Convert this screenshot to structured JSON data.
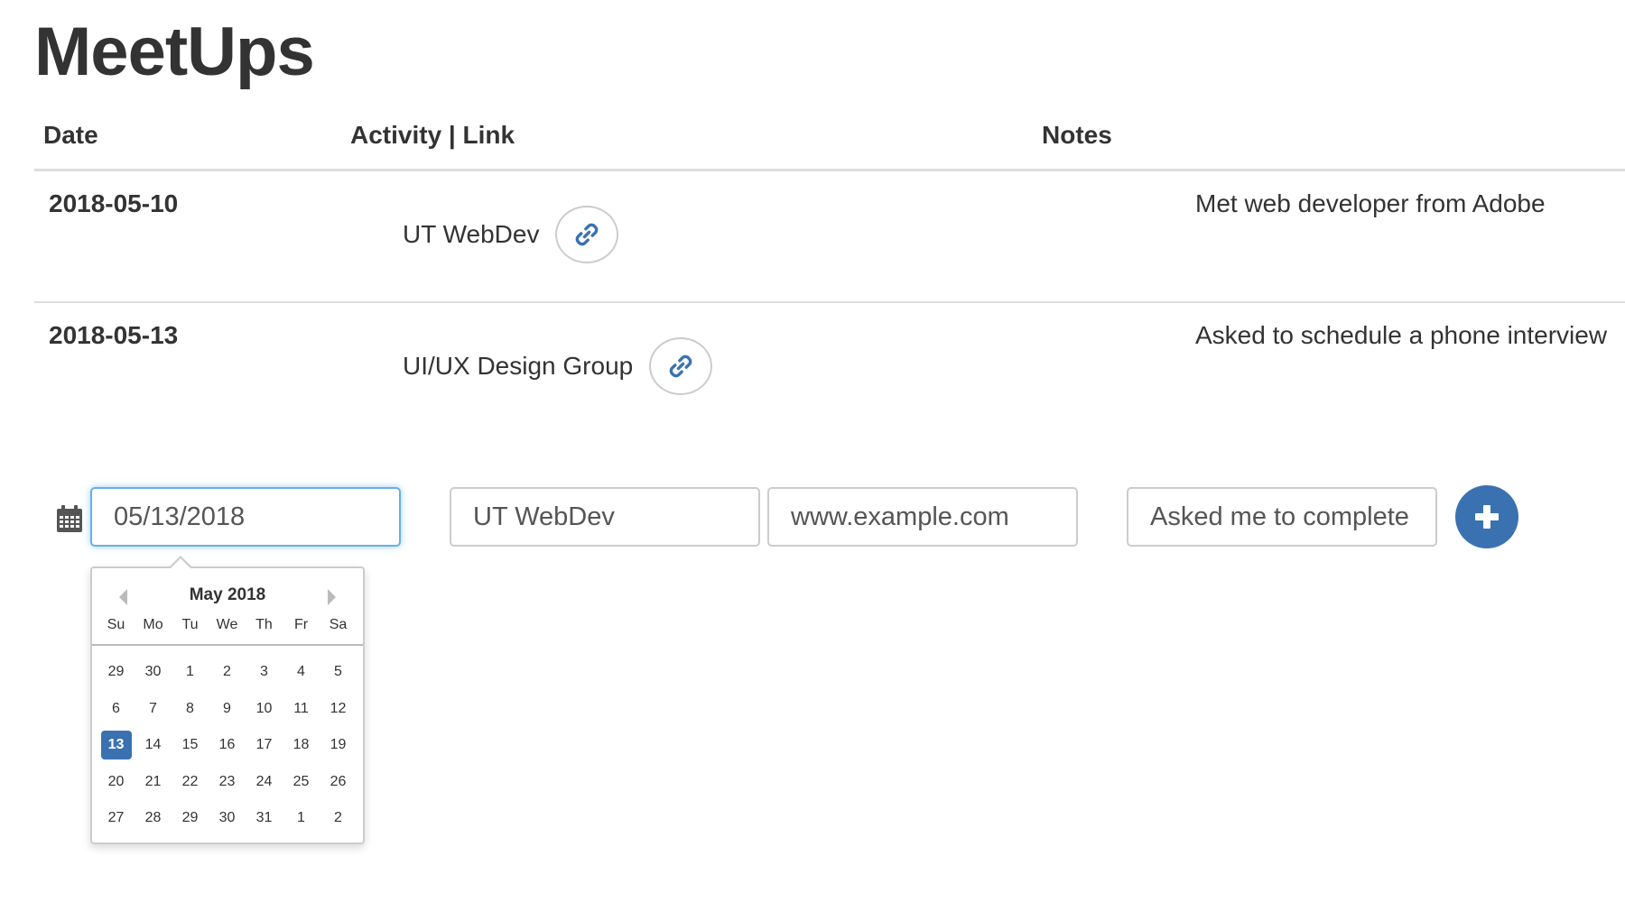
{
  "page": {
    "title": "MeetUps"
  },
  "table": {
    "headers": {
      "date": "Date",
      "activity": "Activity | Link",
      "notes": "Notes"
    },
    "rows": [
      {
        "date": "2018-05-10",
        "activity": "UT WebDev",
        "notes": "Met web developer from Adobe",
        "link_icon": "link-icon"
      },
      {
        "date": "2018-05-13",
        "activity": "UI/UX Design Group",
        "notes": "Asked to schedule a phone interview",
        "link_icon": "link-icon"
      }
    ]
  },
  "form": {
    "date_value": "05/13/2018",
    "activity_value": "UT WebDev",
    "link_value": "www.example.com",
    "notes_value": "Asked me to complete a",
    "add_icon": "plus-icon",
    "calendar_icon": "calendar-icon"
  },
  "datepicker": {
    "title": "May 2018",
    "weekdays": [
      "Su",
      "Mo",
      "Tu",
      "We",
      "Th",
      "Fr",
      "Sa"
    ],
    "weeks": [
      [
        "29",
        "30",
        "1",
        "2",
        "3",
        "4",
        "5"
      ],
      [
        "6",
        "7",
        "8",
        "9",
        "10",
        "11",
        "12"
      ],
      [
        "13",
        "14",
        "15",
        "16",
        "17",
        "18",
        "19"
      ],
      [
        "20",
        "21",
        "22",
        "23",
        "24",
        "25",
        "26"
      ],
      [
        "27",
        "28",
        "29",
        "30",
        "31",
        "1",
        "2"
      ]
    ],
    "selected": "13"
  },
  "colors": {
    "accent": "#3a72b1",
    "focus_border": "#66afe9",
    "text": "#333333",
    "border": "#cccccc"
  }
}
